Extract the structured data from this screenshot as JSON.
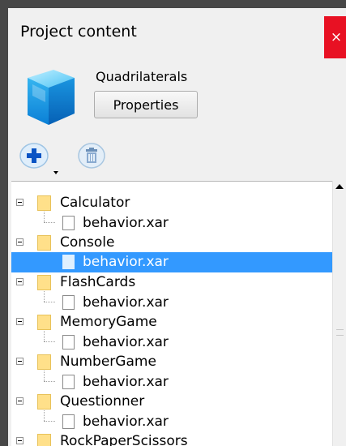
{
  "window": {
    "title": "Project content",
    "close_glyph": "×"
  },
  "project": {
    "name": "Quadrilaterals",
    "properties_label": "Properties",
    "icon": "cube-icon"
  },
  "toolbar": {
    "add_icon": "plus-icon",
    "delete_icon": "trash-icon"
  },
  "tree": {
    "items": [
      {
        "folder": "Calculator",
        "file": "behavior.xar",
        "selected": false
      },
      {
        "folder": "Console",
        "file": "behavior.xar",
        "selected": true
      },
      {
        "folder": "FlashCards",
        "file": "behavior.xar",
        "selected": false
      },
      {
        "folder": "MemoryGame",
        "file": "behavior.xar",
        "selected": false
      },
      {
        "folder": "NumberGame",
        "file": "behavior.xar",
        "selected": false
      },
      {
        "folder": "Questionner",
        "file": "behavior.xar",
        "selected": false
      },
      {
        "folder": "RockPaperScissors",
        "file": "",
        "selected": false
      }
    ]
  },
  "colors": {
    "selection": "#3399ff",
    "close": "#e81123",
    "folder": "#ffe08a"
  }
}
